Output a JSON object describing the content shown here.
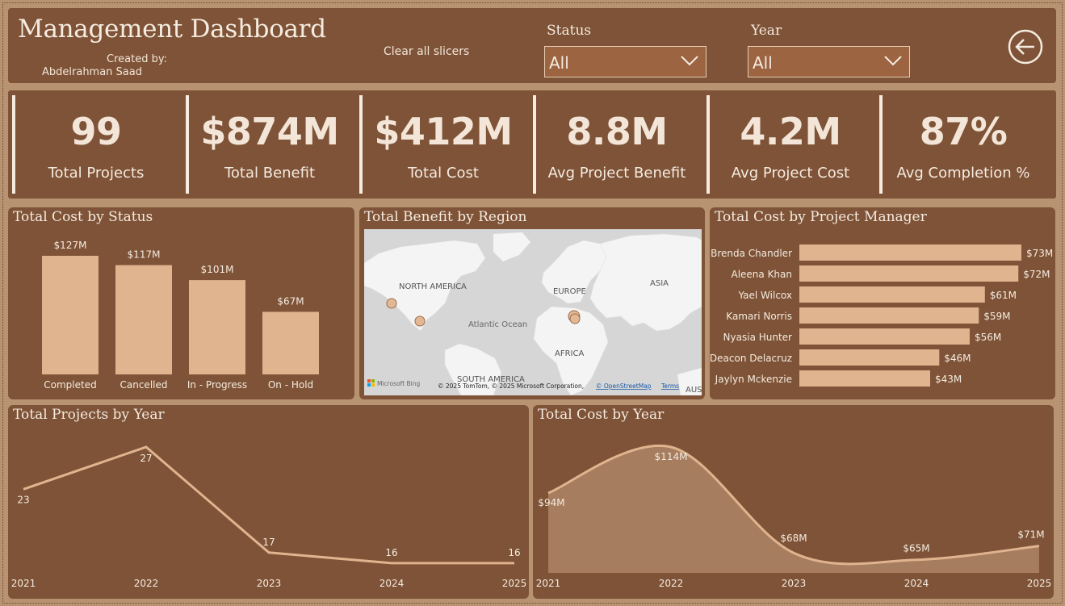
{
  "header": {
    "title": "Management Dashboard",
    "created_by_label": "Created by:",
    "author": "Abdelrahman Saad",
    "clear_slicers": "Clear all slicers",
    "status_slicer": {
      "label": "Status",
      "value": "All"
    },
    "year_slicer": {
      "label": "Year",
      "value": "All"
    },
    "back_icon": "arrow-left-circle-icon"
  },
  "kpis": [
    {
      "value": "99",
      "label": "Total Projects"
    },
    {
      "value": "$874M",
      "label": "Total Benefit"
    },
    {
      "value": "$412M",
      "label": "Total Cost"
    },
    {
      "value": "8.8M",
      "label": "Avg Project Benefit"
    },
    {
      "value": "4.2M",
      "label": "Avg Project Cost"
    },
    {
      "value": "87%",
      "label": "Avg Completion %"
    }
  ],
  "colors": {
    "background": "#b89372",
    "panel": "#7e5337",
    "bar": "#dfb48f",
    "text": "#f5ebe0",
    "area_fill": "#a77d5f"
  },
  "map": {
    "title": "Total Benefit by Region",
    "labels": {
      "north_america": "NORTH AMERICA",
      "europe": "EUROPE",
      "asia": "ASIA",
      "atlantic": "Atlantic Ocean",
      "africa": "AFRICA",
      "south_america": "SOUTH AMERICA",
      "aus": "AUS"
    },
    "bing_logo": "Microsoft Bing",
    "attribution": "© 2025 TomTom, © 2025 Microsoft Corporation,",
    "osm_link": "© OpenStreetMap",
    "terms_link": "Terms"
  },
  "chart_data": [
    {
      "type": "bar",
      "title": "Total Cost by Status",
      "categories": [
        "Completed",
        "Cancelled",
        "In - Progress",
        "On - Hold"
      ],
      "values": [
        127,
        117,
        101,
        67
      ],
      "data_labels": [
        "$127M",
        "$117M",
        "$101M",
        "$67M"
      ],
      "ylim": [
        0,
        127
      ]
    },
    {
      "type": "bar",
      "orientation": "horizontal",
      "title": "Total Cost by Project Manager",
      "categories": [
        "Brenda Chandler",
        "Aleena Khan",
        "Yael Wilcox",
        "Kamari Norris",
        "Nyasia Hunter",
        "Deacon Delacruz",
        "Jaylyn Mckenzie"
      ],
      "values": [
        73,
        72,
        61,
        59,
        56,
        46,
        43
      ],
      "data_labels": [
        "$73M",
        "$72M",
        "$61M",
        "$59M",
        "$56M",
        "$46M",
        "$43M"
      ]
    },
    {
      "type": "line",
      "title": "Total Projects by Year",
      "x": [
        "2021",
        "2022",
        "2023",
        "2024",
        "2025"
      ],
      "values": [
        23,
        27,
        17,
        16,
        16
      ],
      "data_labels": [
        "23",
        "27",
        "17",
        "16",
        "16"
      ],
      "ylim": [
        15,
        27
      ]
    },
    {
      "type": "area",
      "title": "Total Cost by Year",
      "x": [
        "2021",
        "2022",
        "2023",
        "2024",
        "2025"
      ],
      "values": [
        94,
        114,
        68,
        65,
        71
      ],
      "data_labels": [
        "$94M",
        "$114M",
        "$68M",
        "$65M",
        "$71M"
      ],
      "ylim": [
        60,
        114
      ]
    }
  ]
}
